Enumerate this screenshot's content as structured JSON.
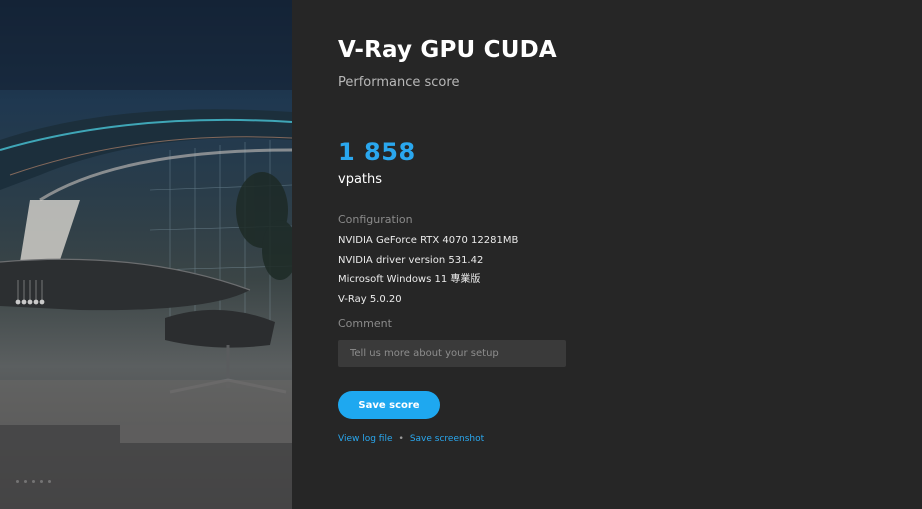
{
  "benchmark": {
    "title": "V-Ray GPU CUDA",
    "subtitle": "Performance score"
  },
  "result": {
    "score": "1 858",
    "unit": "vpaths"
  },
  "configuration": {
    "label": "Configuration",
    "items": [
      "NVIDIA GeForce RTX 4070 12281MB",
      "NVIDIA driver version 531.42",
      "Microsoft Windows 11 專業版",
      "V-Ray 5.0.20"
    ]
  },
  "comment": {
    "label": "Comment",
    "placeholder": "Tell us more about your setup",
    "value": ""
  },
  "actions": {
    "save_label": "Save score",
    "view_log_label": "View log file",
    "separator": "•",
    "save_screenshot_label": "Save screenshot"
  },
  "colors": {
    "accent": "#1ea8f0",
    "panel_bg": "#262626",
    "input_bg": "#3a3a3a"
  }
}
